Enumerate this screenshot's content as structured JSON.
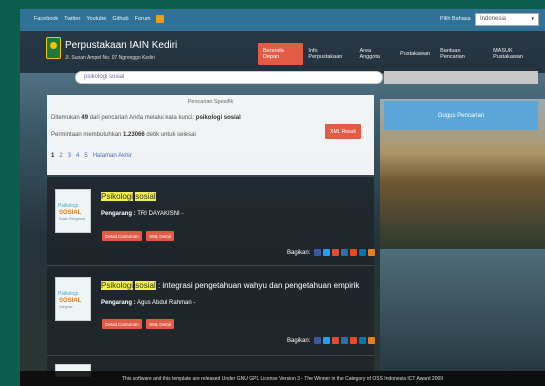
{
  "topbar": {
    "links": [
      "Facebook",
      "Twitter",
      "Youtube",
      "Github",
      "Forum"
    ],
    "lang_label": "Pilih Bahasa",
    "lang_value": "Indonesia"
  },
  "header": {
    "site_title": "Perpustakaan IAIN Kediri",
    "site_address": "Jl. Sunan Ampel No. 07 Ngronggo Kediri",
    "nav": [
      "Beranda Depan",
      "Info Perpustakaan",
      "Area Anggota",
      "Pustakawan",
      "Bantuan Pencarian",
      "MASUK Pustakawan"
    ]
  },
  "search": {
    "value": "psikologi sosial"
  },
  "sidebar": {
    "button": "Gugus Pencarian"
  },
  "results": {
    "title": "Pencarian Spesifik",
    "found_prefix": "Ditemukan",
    "found_count": "49",
    "found_mid": "dari pencarian Anda melalui kata kunci:",
    "keyword": "psikologi sosial",
    "time_prefix": "Permintaan membutuhkan",
    "time_value": "1.23066",
    "time_suffix": "detik untuk selesai",
    "xml_button": "XML Result",
    "pages": [
      "1",
      "2",
      "3",
      "4",
      "5"
    ],
    "last_page": "Halaman Akhir"
  },
  "items": [
    {
      "cover_title": "Psikologi",
      "cover_sub": "SOSIAL",
      "cover_label": "Suatu Pengantar",
      "title_hl1": "Psikologi",
      "title_hl2": "sosial",
      "title_rest": "",
      "author_label": "Pengarang :",
      "author": "TRI DAYAKISNI -",
      "btn_detail": "Detail Cantuman",
      "btn_xml": "XML Detail",
      "share_label": "Bagikan:"
    },
    {
      "cover_title": "Psikologi",
      "cover_sub": "SOSIAL",
      "cover_label": "Integrasi",
      "title_hl1": "Psikologi",
      "title_hl2": "sosial",
      "title_rest": ": integrasi pengetahuan wahyu dan pengetahuan empirik",
      "author_label": "Pengarang :",
      "author": "Agus Abdul Rahman -",
      "btn_detail": "Detail Cantuman",
      "btn_xml": "XML Detail",
      "share_label": "Bagikan:"
    }
  ],
  "share_icons": [
    {
      "name": "facebook-icon",
      "color": "#3b5998"
    },
    {
      "name": "twitter-icon",
      "color": "#1da1f2"
    },
    {
      "name": "google-plus-icon",
      "color": "#dd4b39"
    },
    {
      "name": "digg-icon",
      "color": "#2a6fb0"
    },
    {
      "name": "stumbleupon-icon",
      "color": "#eb4924"
    },
    {
      "name": "linkedin-icon",
      "color": "#0077b5"
    },
    {
      "name": "email-icon",
      "color": "#e67e22"
    }
  ],
  "footer": "This software and this template are released Under GNU GPL License Version 3 - The Winner in the Category of OSS Indonesia ICT Award 2009"
}
